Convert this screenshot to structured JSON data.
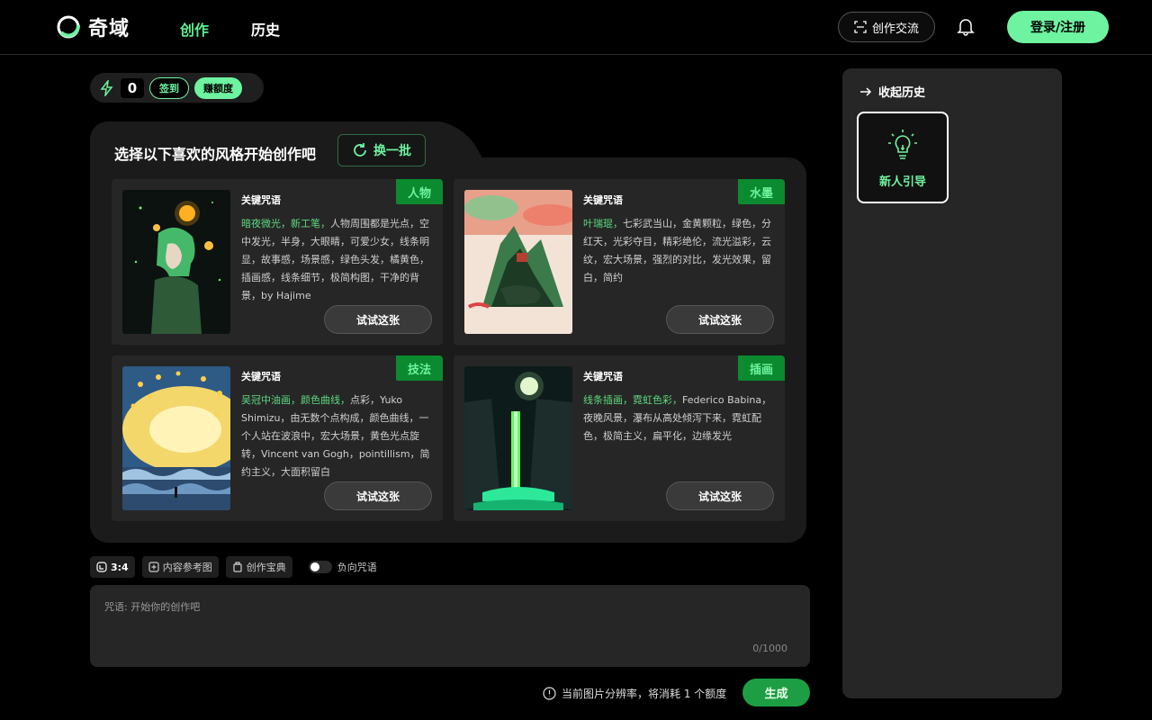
{
  "app": {
    "name": "奇域"
  },
  "nav": {
    "create": "创作",
    "history": "历史"
  },
  "header": {
    "exchange": "创作交流",
    "login": "登录/注册"
  },
  "credits": {
    "count": "0",
    "checkin": "签到",
    "earn": "赚额度"
  },
  "panel": {
    "title": "选择以下喜欢的风格开始创作吧",
    "refresh": "换一批",
    "cards": [
      {
        "label": "关键咒语",
        "tag": "人物",
        "highlight": "暗夜微光，新工笔，",
        "desc": "人物周围都是光点，空中发光，半身，大眼睛，可爱少女，线条明显，故事感，场景感，绿色头发，橘黄色，插画感，线条细节，极简构图，干净的背景，by Hajime",
        "try": "试试这张"
      },
      {
        "label": "关键咒语",
        "tag": "水墨",
        "highlight": "叶瑞琨，",
        "desc": "七彩武当山，金黄颗粒，绿色，分红天，光彩夺目，精彩绝伦，流光溢彩，云纹，宏大场景，强烈的对比，发光效果，留白，简约",
        "try": "试试这张"
      },
      {
        "label": "关键咒语",
        "tag": "技法",
        "highlight": "吴冠中油画，颜色曲线，",
        "desc": "点彩，Yuko Shimizu，由无数个点构成，颜色曲线，一个人站在波浪中，宏大场景，黄色光点旋转，Vincent van Gogh，pointillism，简约主义，大面积留白",
        "try": "试试这张"
      },
      {
        "label": "关键咒语",
        "tag": "插画",
        "highlight": "线条插画，霓虹色彩，",
        "desc": "Federico Babina，夜晚风景，瀑布从高处倾泻下来，霓虹配色，极简主义，扁平化，边缘发光",
        "try": "试试这张"
      }
    ]
  },
  "options": {
    "ratio": "3:4",
    "ref": "内容参考图",
    "book": "创作宝典",
    "negative": "负向咒语"
  },
  "prompt": {
    "placeholder": "咒语: 开始你的创作吧",
    "count": "0/1000"
  },
  "notice": "当前图片分辨率，将消耗 1 个额度",
  "generate": "生成",
  "sidebar": {
    "collapse": "收起历史",
    "guide": "新人引导"
  },
  "colors": {
    "accent": "#6ef3a0",
    "tag_bg": "#0b8a2f",
    "generate_bg": "#1e9e44"
  },
  "icons": [
    "logo-icon",
    "scan-icon",
    "bell-icon",
    "bolt-icon",
    "refresh-icon",
    "ratio-icon",
    "plus-icon",
    "book-icon",
    "info-icon",
    "arrow-right-icon",
    "bulb-icon"
  ]
}
